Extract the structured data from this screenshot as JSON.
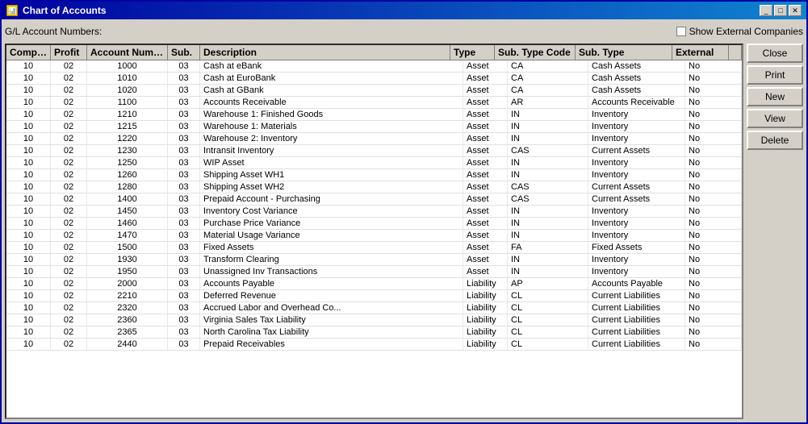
{
  "window": {
    "title": "Chart of Accounts",
    "icon": "chart-icon"
  },
  "title_buttons": {
    "minimize": "_",
    "maximize": "□",
    "close": "✕"
  },
  "toolbar": {
    "gl_label": "G/L Account Numbers:",
    "show_external_label": "Show External Companies",
    "checkbox_checked": false
  },
  "buttons": {
    "close": "Close",
    "print": "Print",
    "new": "New",
    "view": "View",
    "delete": "Delete"
  },
  "table": {
    "headers": [
      "Company",
      "Profit",
      "Account Number",
      "Sub.",
      "Description",
      "Type",
      "Sub. Type Code",
      "Sub. Type",
      "External"
    ],
    "rows": [
      [
        "10",
        "02",
        "1000",
        "03",
        "Cash at eBank",
        "Asset",
        "CA",
        "Cash Assets",
        "No"
      ],
      [
        "10",
        "02",
        "1010",
        "03",
        "Cash at EuroBank",
        "Asset",
        "CA",
        "Cash Assets",
        "No"
      ],
      [
        "10",
        "02",
        "1020",
        "03",
        "Cash at GBank",
        "Asset",
        "CA",
        "Cash Assets",
        "No"
      ],
      [
        "10",
        "02",
        "1100",
        "03",
        "Accounts Receivable",
        "Asset",
        "AR",
        "Accounts Receivable",
        "No"
      ],
      [
        "10",
        "02",
        "1210",
        "03",
        "Warehouse 1: Finished Goods",
        "Asset",
        "IN",
        "Inventory",
        "No"
      ],
      [
        "10",
        "02",
        "1215",
        "03",
        "Warehouse 1: Materials",
        "Asset",
        "IN",
        "Inventory",
        "No"
      ],
      [
        "10",
        "02",
        "1220",
        "03",
        "Warehouse 2: Inventory",
        "Asset",
        "IN",
        "Inventory",
        "No"
      ],
      [
        "10",
        "02",
        "1230",
        "03",
        "Intransit Inventory",
        "Asset",
        "CAS",
        "Current Assets",
        "No"
      ],
      [
        "10",
        "02",
        "1250",
        "03",
        "WIP Asset",
        "Asset",
        "IN",
        "Inventory",
        "No"
      ],
      [
        "10",
        "02",
        "1260",
        "03",
        "Shipping Asset WH1",
        "Asset",
        "IN",
        "Inventory",
        "No"
      ],
      [
        "10",
        "02",
        "1280",
        "03",
        "Shipping Asset WH2",
        "Asset",
        "CAS",
        "Current Assets",
        "No"
      ],
      [
        "10",
        "02",
        "1400",
        "03",
        "Prepaid Account - Purchasing",
        "Asset",
        "CAS",
        "Current Assets",
        "No"
      ],
      [
        "10",
        "02",
        "1450",
        "03",
        "Inventory Cost Variance",
        "Asset",
        "IN",
        "Inventory",
        "No"
      ],
      [
        "10",
        "02",
        "1460",
        "03",
        "Purchase Price Variance",
        "Asset",
        "IN",
        "Inventory",
        "No"
      ],
      [
        "10",
        "02",
        "1470",
        "03",
        "Material Usage Variance",
        "Asset",
        "IN",
        "Inventory",
        "No"
      ],
      [
        "10",
        "02",
        "1500",
        "03",
        "Fixed Assets",
        "Asset",
        "FA",
        "Fixed Assets",
        "No"
      ],
      [
        "10",
        "02",
        "1930",
        "03",
        "Transform Clearing",
        "Asset",
        "IN",
        "Inventory",
        "No"
      ],
      [
        "10",
        "02",
        "1950",
        "03",
        "Unassigned Inv Transactions",
        "Asset",
        "IN",
        "Inventory",
        "No"
      ],
      [
        "10",
        "02",
        "2000",
        "03",
        "Accounts Payable",
        "Liability",
        "AP",
        "Accounts Payable",
        "No"
      ],
      [
        "10",
        "02",
        "2210",
        "03",
        "Deferred Revenue",
        "Liability",
        "CL",
        "Current Liabilities",
        "No"
      ],
      [
        "10",
        "02",
        "2320",
        "03",
        "Accrued Labor and Overhead Co...",
        "Liability",
        "CL",
        "Current Liabilities",
        "No"
      ],
      [
        "10",
        "02",
        "2360",
        "03",
        "Virginia Sales Tax Liability",
        "Liability",
        "CL",
        "Current Liabilities",
        "No"
      ],
      [
        "10",
        "02",
        "2365",
        "03",
        "North Carolina Tax Liability",
        "Liability",
        "CL",
        "Current Liabilities",
        "No"
      ],
      [
        "10",
        "02",
        "2440",
        "03",
        "Prepaid Receivables",
        "Liability",
        "CL",
        "Current Liabilities",
        "No"
      ]
    ]
  }
}
